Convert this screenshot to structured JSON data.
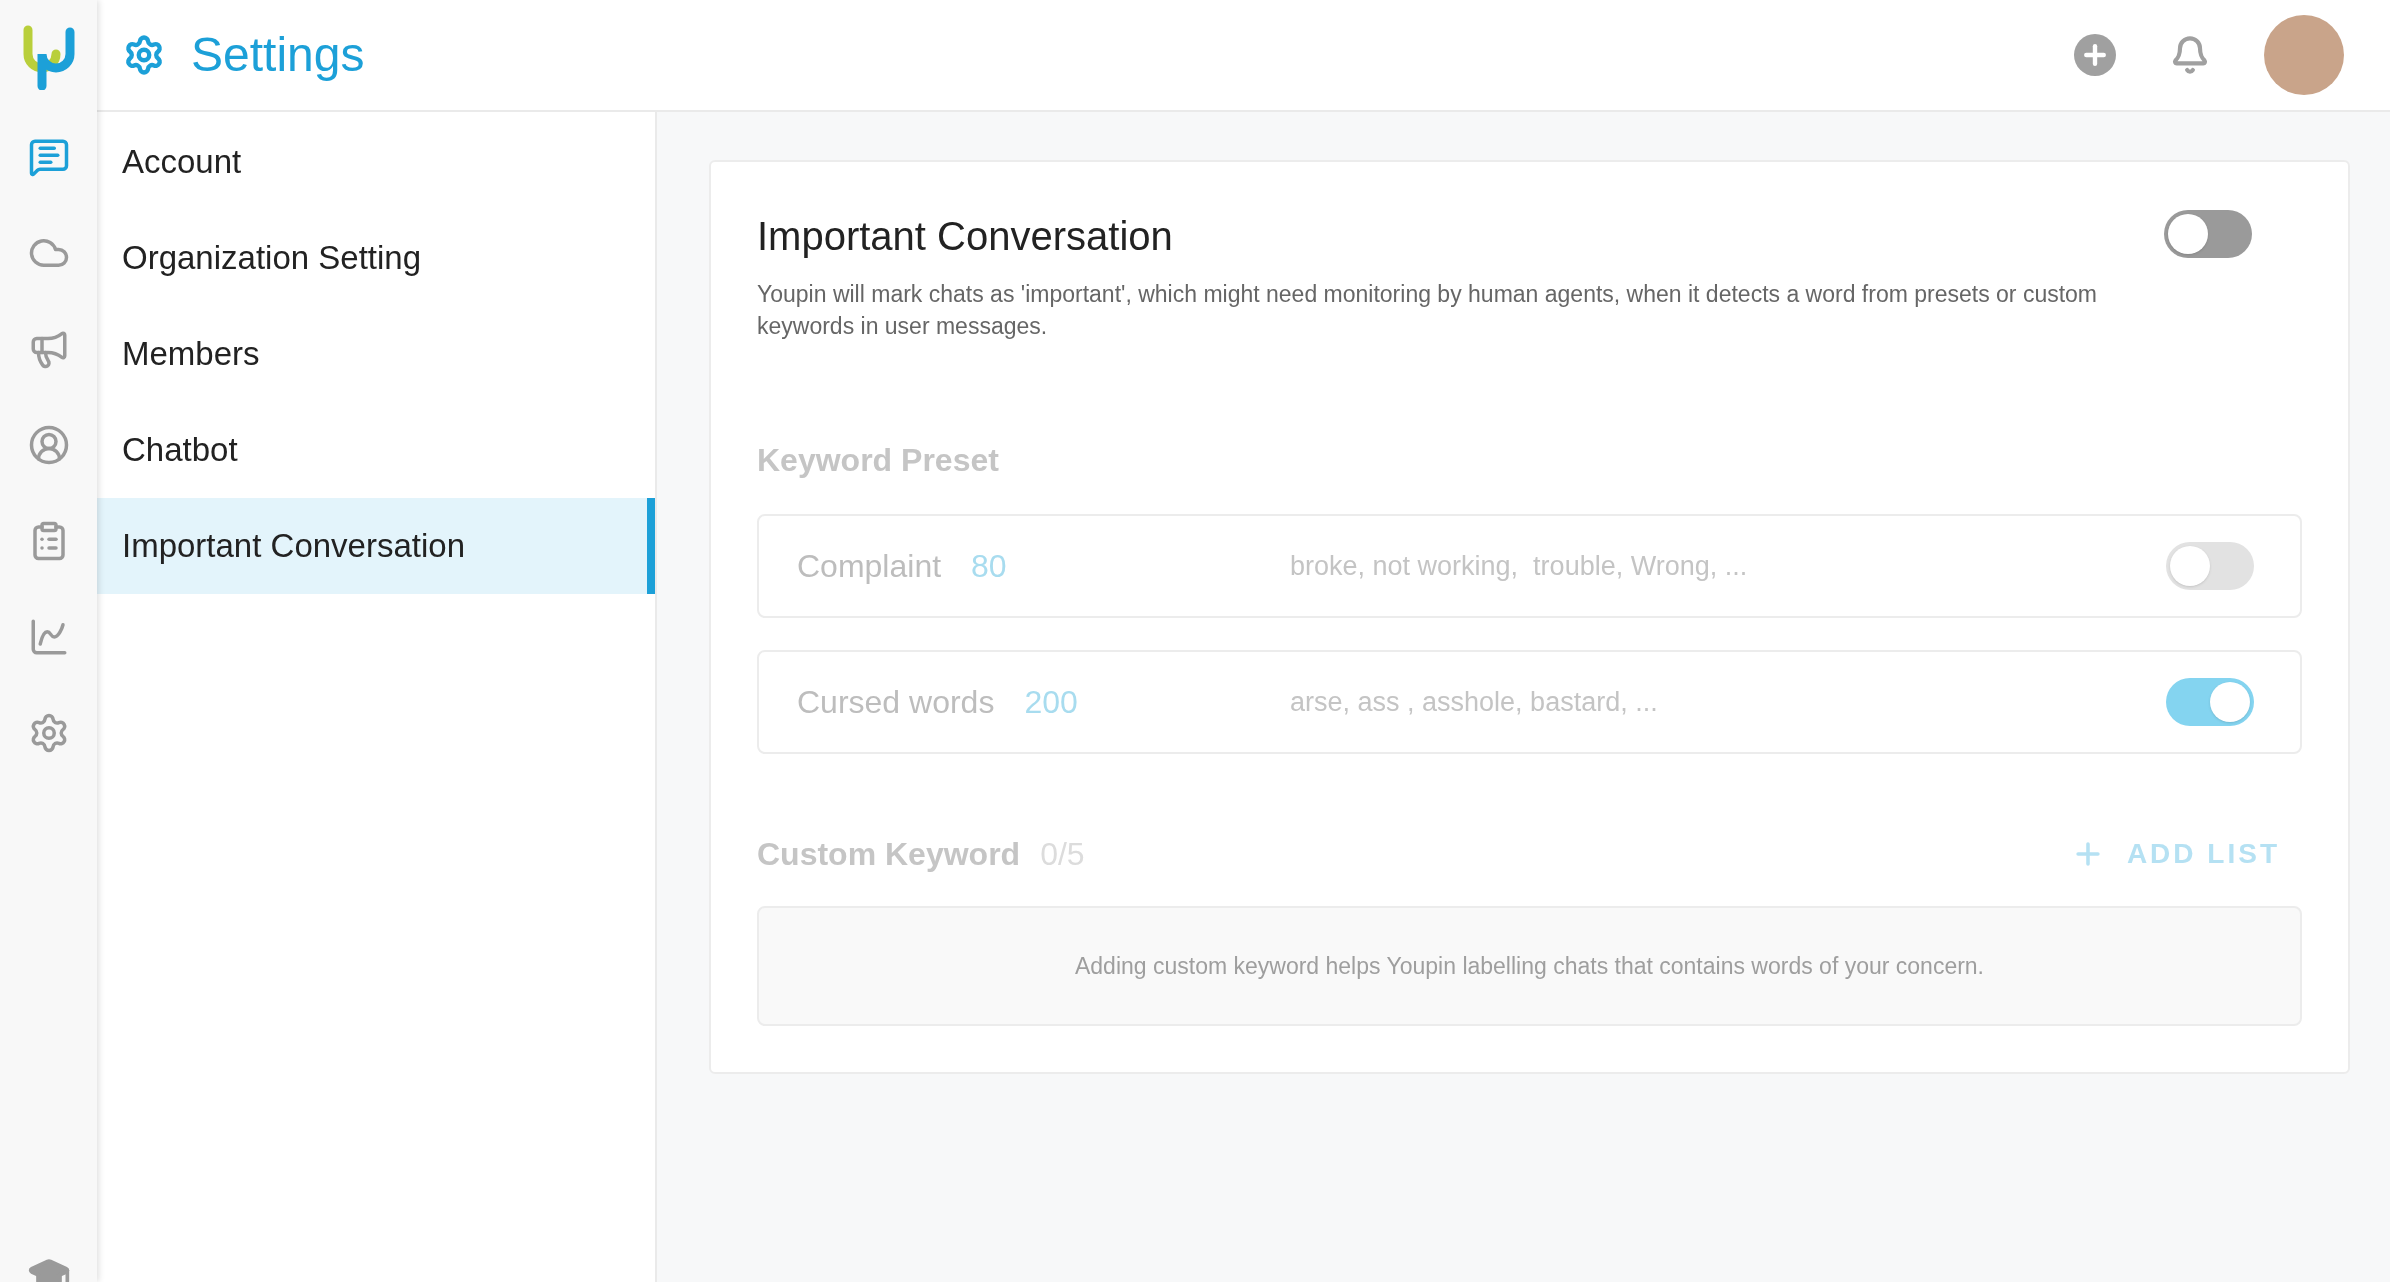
{
  "rail": {
    "items": [
      {
        "selected": true
      },
      {
        "selected": false
      },
      {
        "selected": false
      },
      {
        "selected": false
      },
      {
        "selected": false
      },
      {
        "selected": false
      },
      {
        "selected": false
      }
    ]
  },
  "header": {
    "title": "Settings"
  },
  "sidebar": {
    "items": [
      {
        "label": "Account",
        "selected": false
      },
      {
        "label": "Organization Setting",
        "selected": false
      },
      {
        "label": "Members",
        "selected": false
      },
      {
        "label": "Chatbot",
        "selected": false
      },
      {
        "label": "Important Conversation",
        "selected": true
      }
    ]
  },
  "card": {
    "title": "Important Conversation",
    "on": false,
    "description": "Youpin will mark chats as 'important', which might need monitoring by human agents, when it detects a word from presets or custom keywords in user messages.",
    "preset_heading": "Keyword Preset",
    "presets": [
      {
        "name": "Complaint",
        "count": "80",
        "words": "broke, not working,  trouble, Wrong, ...",
        "on": false
      },
      {
        "name": "Cursed words",
        "count": "200",
        "words": "arse, ass , asshole, bastard, ...",
        "on": true
      }
    ],
    "custom_heading": "Custom Keyword",
    "custom_count": "0/5",
    "add_button": "ADD LIST",
    "custom_empty": "Adding custom keyword helps Youpin labelling chats that contains words of your concern."
  }
}
